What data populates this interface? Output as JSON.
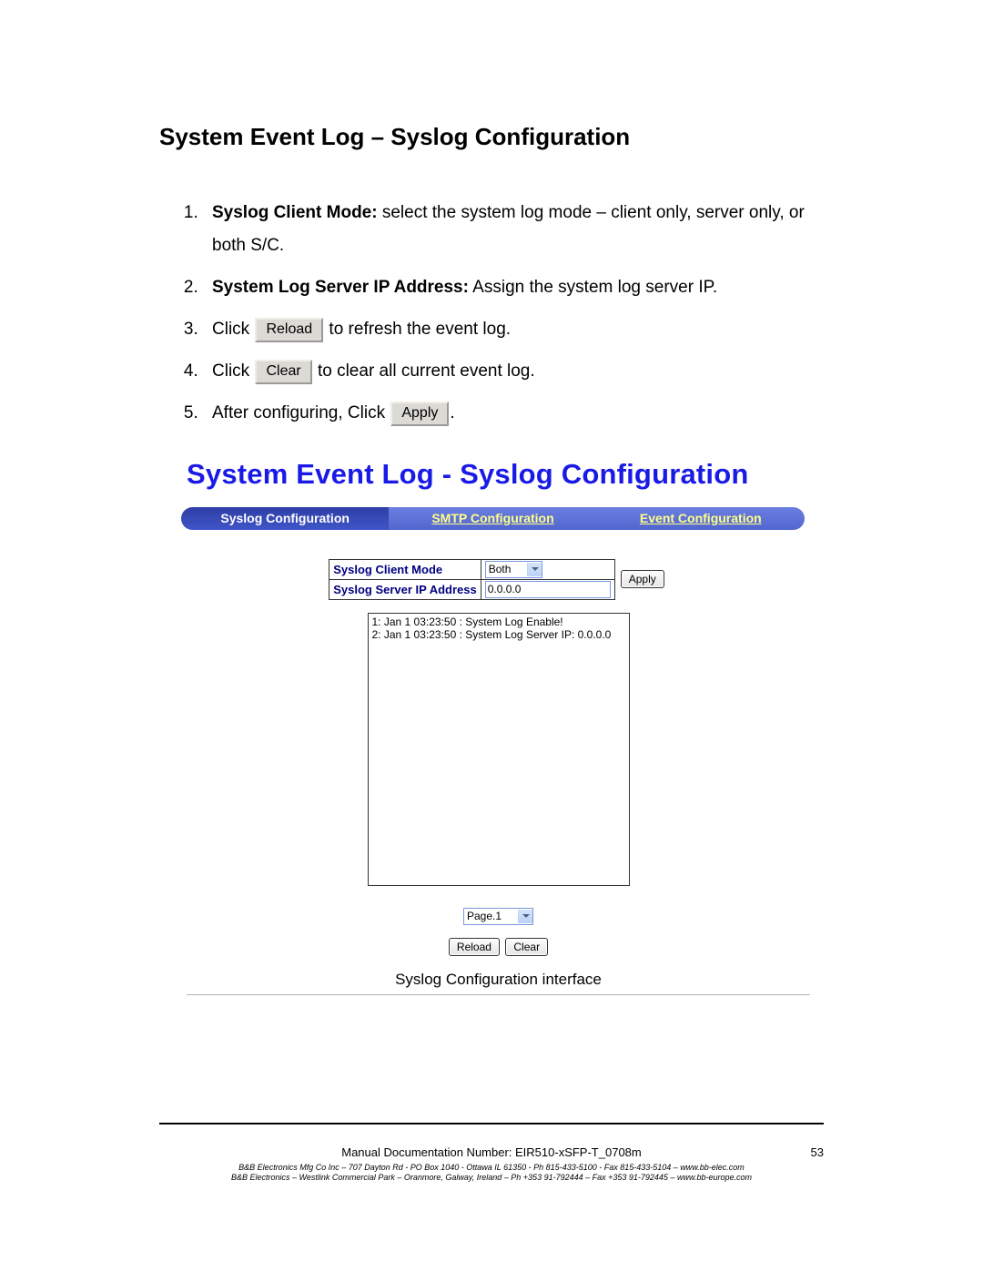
{
  "section_title": "System Event Log – Syslog Configuration",
  "instructions": {
    "i1": {
      "bold": "Syslog Client Mode:",
      "rest": " select the system log mode – client only, server only, or both S/C."
    },
    "i2": {
      "bold": "System Log Server IP Address:",
      "rest": " Assign the system log server IP."
    },
    "i3": {
      "pre": "Click ",
      "btn": "Reload",
      "post": " to refresh the event log."
    },
    "i4": {
      "pre": "Click ",
      "btn": "Clear",
      "post": " to clear all current event log."
    },
    "i5": {
      "pre": "After configuring, Click ",
      "btn": "Apply",
      "post": "."
    }
  },
  "screenshot": {
    "title": "System Event Log - Syslog Configuration",
    "tabs": {
      "t1": "Syslog Configuration",
      "t2": "SMTP Configuration",
      "t3": "Event Configuration"
    },
    "form": {
      "row1_label": "Syslog Client Mode",
      "row1_value": "Both",
      "row2_label": "Syslog Server IP Address",
      "row2_value": "0.0.0.0",
      "apply": "Apply"
    },
    "log": {
      "l1": "1: Jan 1 03:23:50 : System Log Enable!",
      "l2": "2: Jan 1 03:23:50 : System Log Server IP: 0.0.0.0"
    },
    "pager": "Page.1",
    "reload": "Reload",
    "clear": "Clear",
    "caption": "Syslog Configuration interface"
  },
  "footer": {
    "docnum": "Manual Documentation Number: EIR510-xSFP-T_0708m",
    "page": "53",
    "line1": "B&B Electronics Mfg Co Inc – 707 Dayton Rd - PO Box 1040 - Ottawa IL 61350 - Ph 815-433-5100 - Fax 815-433-5104 – www.bb-elec.com",
    "line2": "B&B Electronics – Westlink Commercial Park – Oranmore, Galway, Ireland – Ph +353 91-792444 – Fax +353 91-792445 – www.bb-europe.com"
  }
}
